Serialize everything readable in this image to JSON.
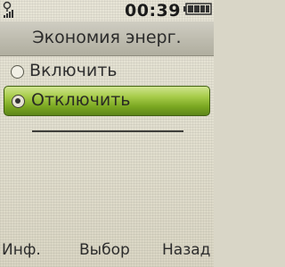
{
  "status_bar": {
    "signal_icon": "signal-strength-icon",
    "time": "00:39",
    "battery_icon": "battery-icon"
  },
  "title": "Экономия энерг.",
  "options": [
    {
      "label": "Включить",
      "selected": false
    },
    {
      "label": "Отключить",
      "selected": true
    }
  ],
  "softkeys": {
    "left": "Инф.",
    "center": "Выбор",
    "right": "Назад"
  },
  "colors": {
    "highlight": "#8bb533",
    "title_bar": "#bdbbae",
    "background": "#e3e0d0"
  }
}
